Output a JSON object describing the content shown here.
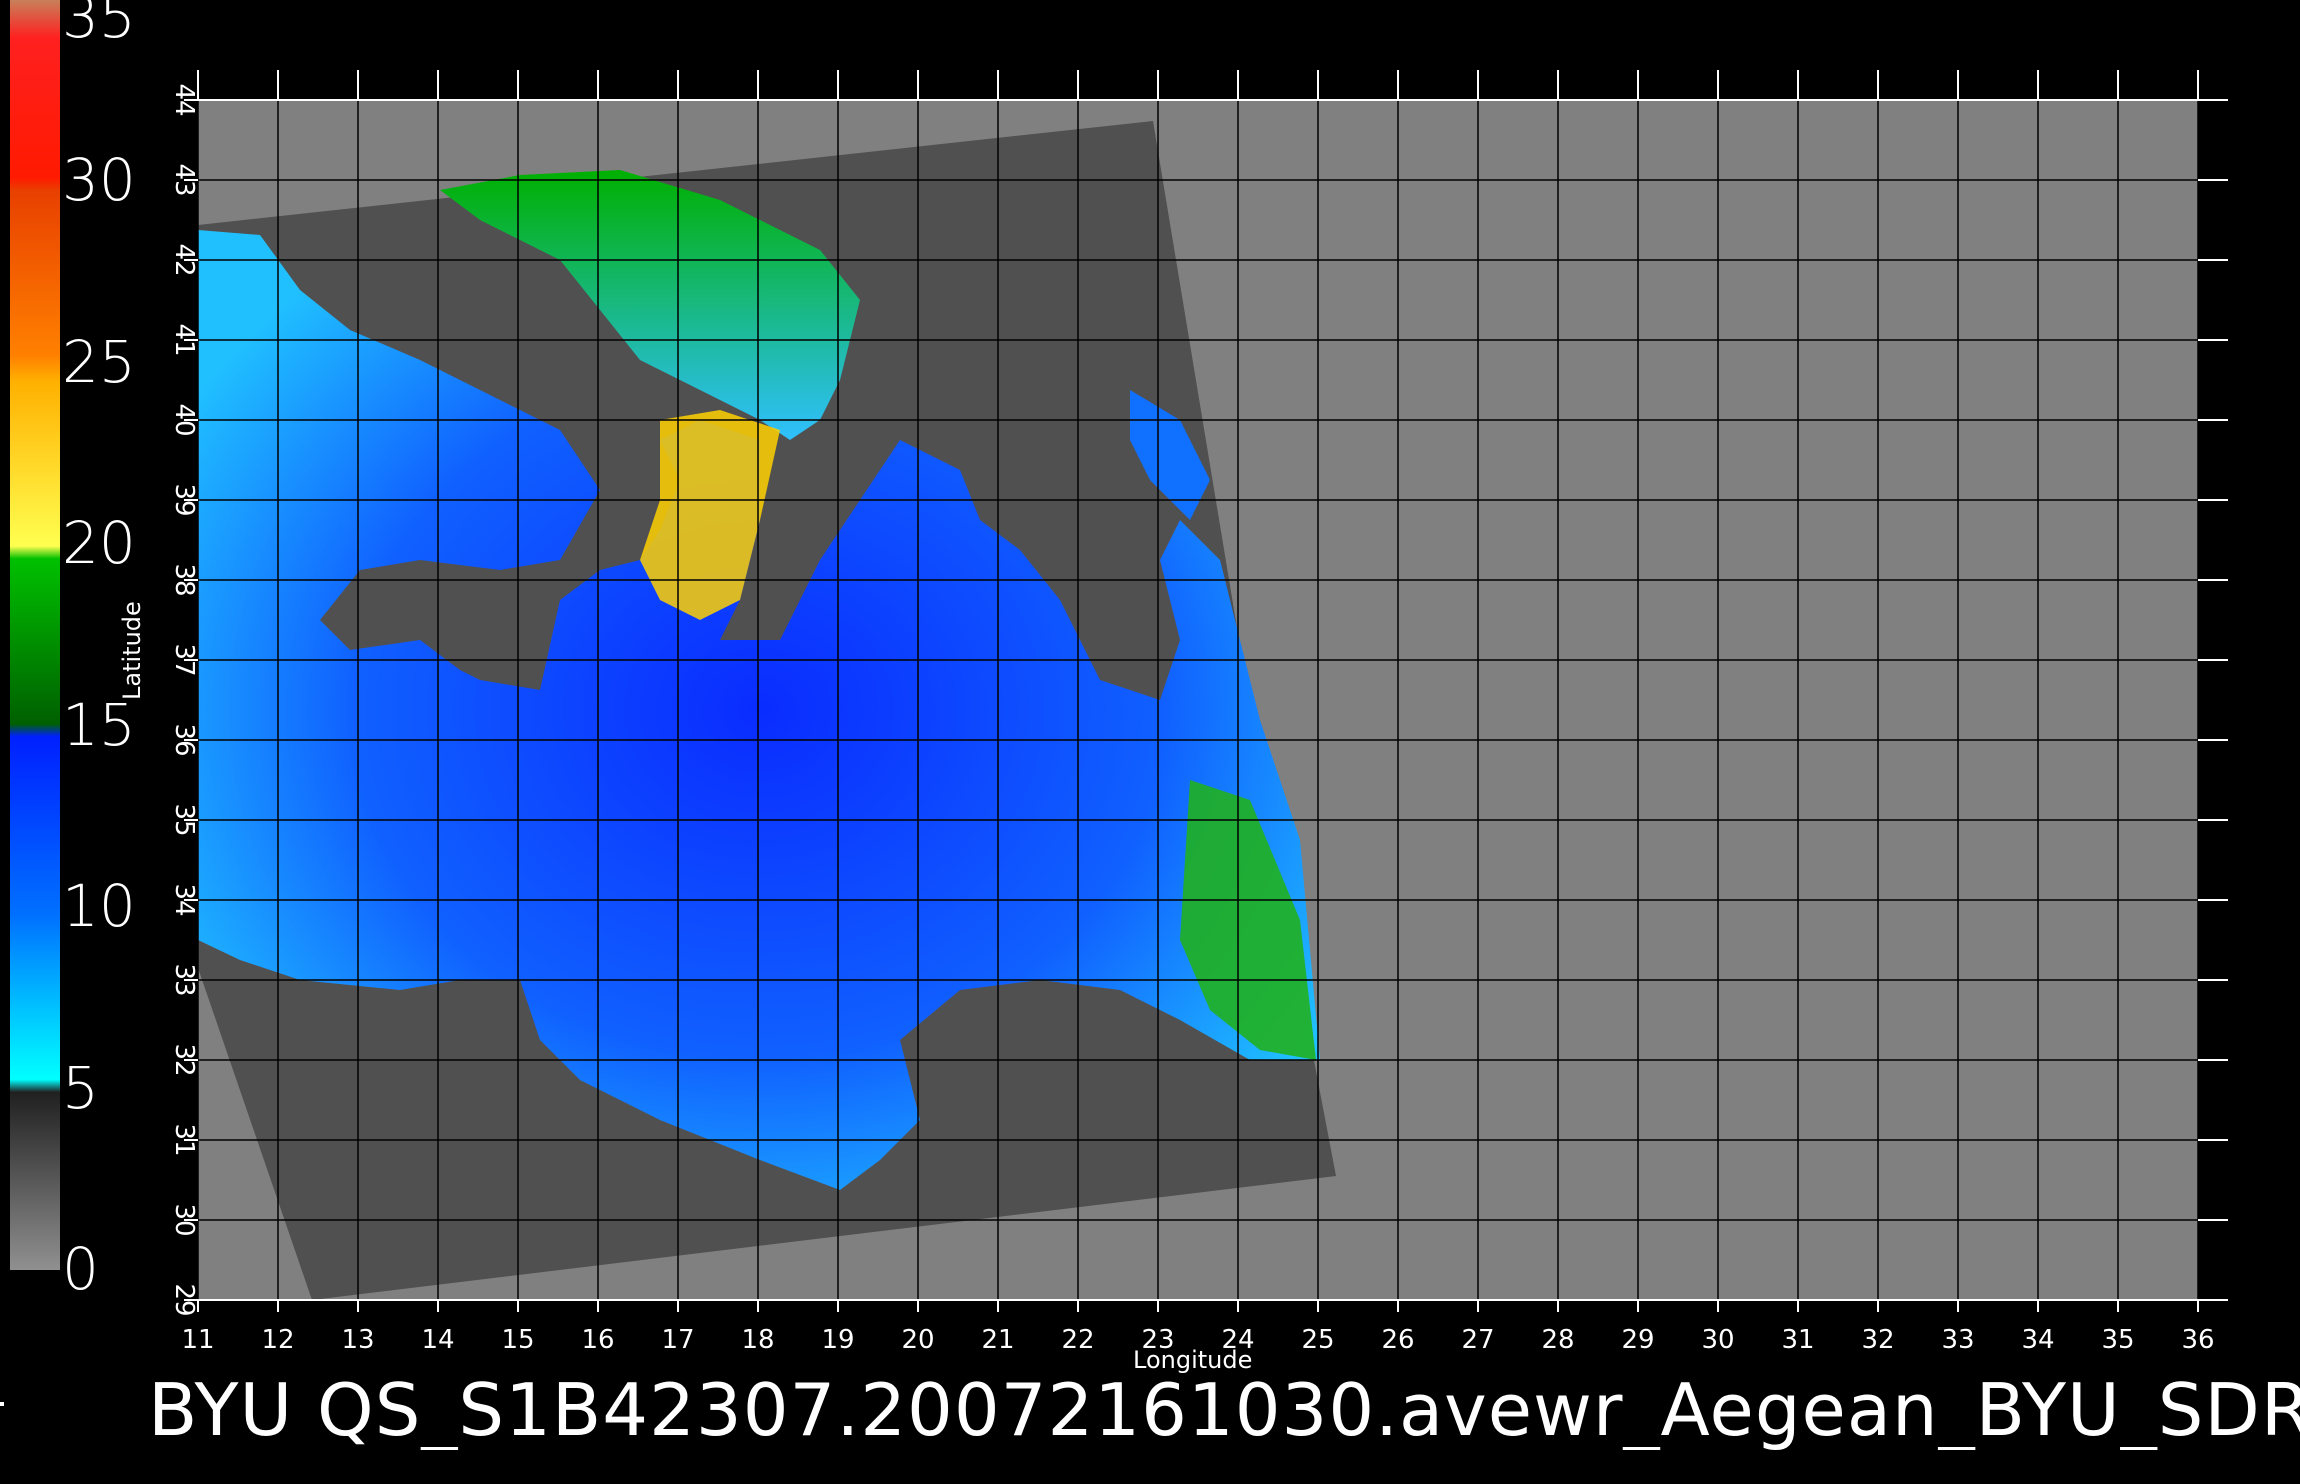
{
  "title": "BYU  QS_S1B42307.20072161030.avewr_Aegean_BYU_SDR",
  "axes": {
    "x_label": "Longitude",
    "y_label": "Latitude",
    "x_ticks": [
      "11",
      "12",
      "13",
      "14",
      "15",
      "16",
      "17",
      "18",
      "19",
      "20",
      "21",
      "22",
      "23",
      "24",
      "25",
      "26",
      "27",
      "28",
      "29",
      "30",
      "31",
      "32",
      "33",
      "34",
      "35",
      "36"
    ],
    "y_ticks": [
      "29",
      "30",
      "31",
      "32",
      "33",
      "34",
      "35",
      "36",
      "37",
      "38",
      "39",
      "40",
      "41",
      "42",
      "43",
      "44"
    ],
    "x_range": [
      11,
      36
    ],
    "y_range": [
      29,
      44
    ]
  },
  "colorbar": {
    "labels": [
      "35",
      "30",
      "25",
      "20",
      "15",
      "10",
      "5",
      "0"
    ],
    "range": [
      0,
      35
    ],
    "colors": [
      "#c8805a",
      "#ff0000",
      "#ff2a00",
      "#ff6a00",
      "#ffb000",
      "#ffe000",
      "#ffff40",
      "#00cc00",
      "#008800",
      "#0030ff",
      "#0070ff",
      "#00b0ff",
      "#00ffff",
      "#404040",
      "#707070",
      "#909090"
    ]
  },
  "colors": {
    "background": "#000000",
    "no_data": "#808080",
    "land": "#505050",
    "grid": "#000000"
  }
}
